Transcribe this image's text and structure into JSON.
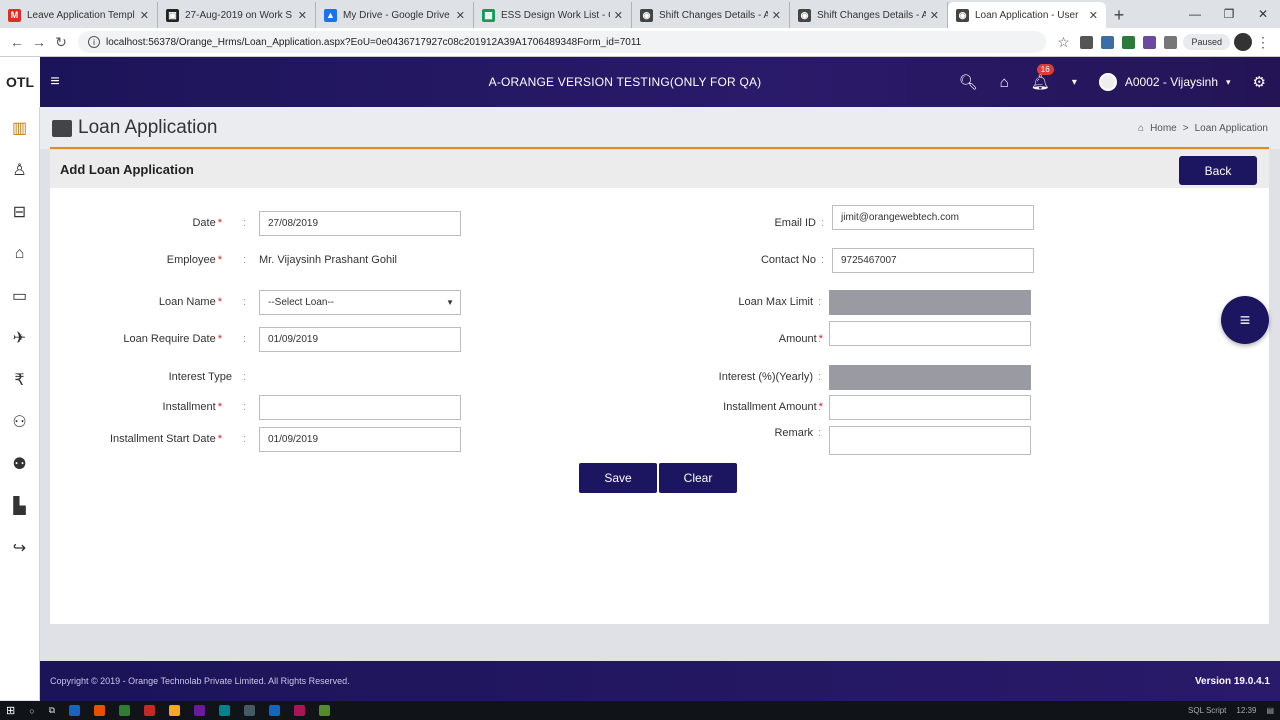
{
  "browser": {
    "tabs": [
      {
        "label": "Leave Application Templ",
        "icon": "gmail-icon",
        "color": "#d93025",
        "glyph": "M"
      },
      {
        "label": "27-Aug-2019 on Work S",
        "icon": "doc-icon",
        "color": "#222222",
        "glyph": "▣"
      },
      {
        "label": "My Drive - Google Drive",
        "icon": "drive-icon",
        "color": "#1a73e8",
        "glyph": "▲"
      },
      {
        "label": "ESS Design Work List - G",
        "icon": "sheets-icon",
        "color": "#0f9d58",
        "glyph": "▦"
      },
      {
        "label": "Shift Changes Details - A",
        "icon": "globe-icon",
        "color": "#444444",
        "glyph": "◉"
      },
      {
        "label": "Shift Changes Details - A",
        "icon": "globe-icon",
        "color": "#444444",
        "glyph": "◉"
      },
      {
        "label": "Loan Application - User",
        "icon": "globe-icon",
        "color": "#444444",
        "glyph": "◉"
      }
    ],
    "url": "localhost:56378/Orange_Hrms/Loan_Application.aspx?EoU=0e0436717927c08c201912A39A1706489348Form_id=7011",
    "paused_label": "Paused"
  },
  "header": {
    "logo": "OTL",
    "title": "A-ORANGE VERSION TESTING(ONLY FOR QA)",
    "notification_count": "16",
    "user": "A0002 - Vijaysinh"
  },
  "page": {
    "title": "Loan Application",
    "breadcrumb": {
      "home": "Home",
      "sep": ">",
      "current": "Loan Application"
    }
  },
  "form": {
    "header": "Add Loan Application",
    "back_label": "Back",
    "date_label": "Date",
    "date_value": "27/08/2019",
    "employee_label": "Employee",
    "employee_value": "Mr. Vijaysinh Prashant Gohil",
    "loan_name_label": "Loan Name",
    "loan_name_value": "--Select Loan--",
    "loan_require_date_label": "Loan Require Date",
    "loan_require_date_value": "01/09/2019",
    "interest_type_label": "Interest Type",
    "installment_label": "Installment",
    "installment_value": "",
    "installment_start_label": "Installment Start Date",
    "installment_start_value": "01/09/2019",
    "email_label": "Email ID",
    "email_value": "jimit@orangewebtech.com",
    "contact_label": "Contact No",
    "contact_value": "9725467007",
    "max_limit_label": "Loan Max Limit",
    "amount_label": "Amount",
    "interest_label": "Interest (%)(Yearly)",
    "installment_amount_label": "Installment Amount",
    "remark_label": "Remark",
    "required_mark": "*",
    "colon": ":",
    "save_label": "Save",
    "clear_label": "Clear"
  },
  "footer": {
    "copyright": "Copyright © 2019 - Orange Technolab Private Limited. All Rights Reserved.",
    "version": "Version 19.0.4.1"
  },
  "taskbar": {
    "tray_text": "SQL Script",
    "clock": "12:39"
  }
}
